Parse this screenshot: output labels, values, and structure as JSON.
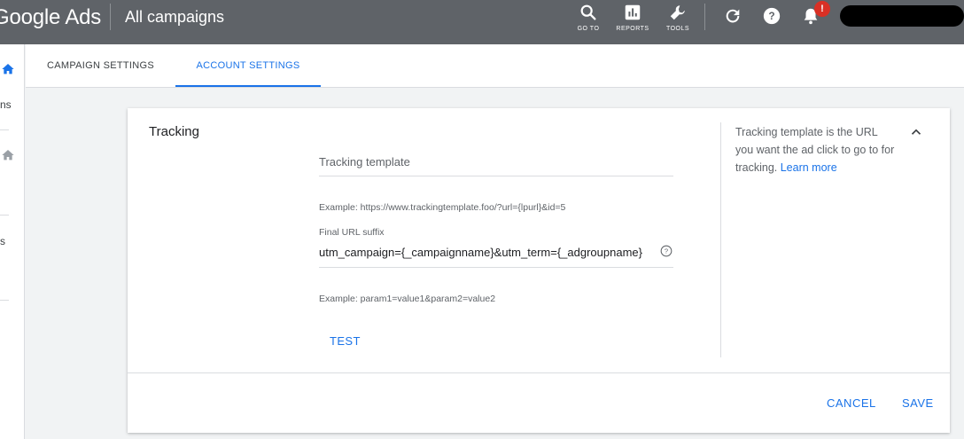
{
  "topbar": {
    "brand": "Google Ads",
    "title": "All campaigns",
    "tools": [
      {
        "label": "GO TO",
        "icon": "search-icon"
      },
      {
        "label": "REPORTS",
        "icon": "reports-icon"
      },
      {
        "label": "TOOLS",
        "icon": "wrench-icon"
      }
    ],
    "notification_badge": "!"
  },
  "leftrail": {
    "items": [
      "ns",
      "s"
    ]
  },
  "tabs": [
    {
      "label": "CAMPAIGN SETTINGS",
      "active": false
    },
    {
      "label": "ACCOUNT SETTINGS",
      "active": true
    }
  ],
  "tracking": {
    "title": "Tracking",
    "template_placeholder": "Tracking template",
    "template_example": "Example: https://www.trackingtemplate.foo/?url={lpurl}&id=5",
    "suffix_label": "Final URL suffix",
    "suffix_value": "utm_campaign={_campaignname}&utm_term={_adgroupname}",
    "suffix_example": "Example: param1=value1&param2=value2",
    "test_label": "TEST",
    "help_text": "Tracking template is the URL you want the ad click to go to for tracking.",
    "learn_more": "Learn more",
    "cancel_label": "CANCEL",
    "save_label": "SAVE"
  },
  "colors": {
    "topbar": "#5f6368",
    "accent": "#1a73e8",
    "badge": "#d93025"
  }
}
